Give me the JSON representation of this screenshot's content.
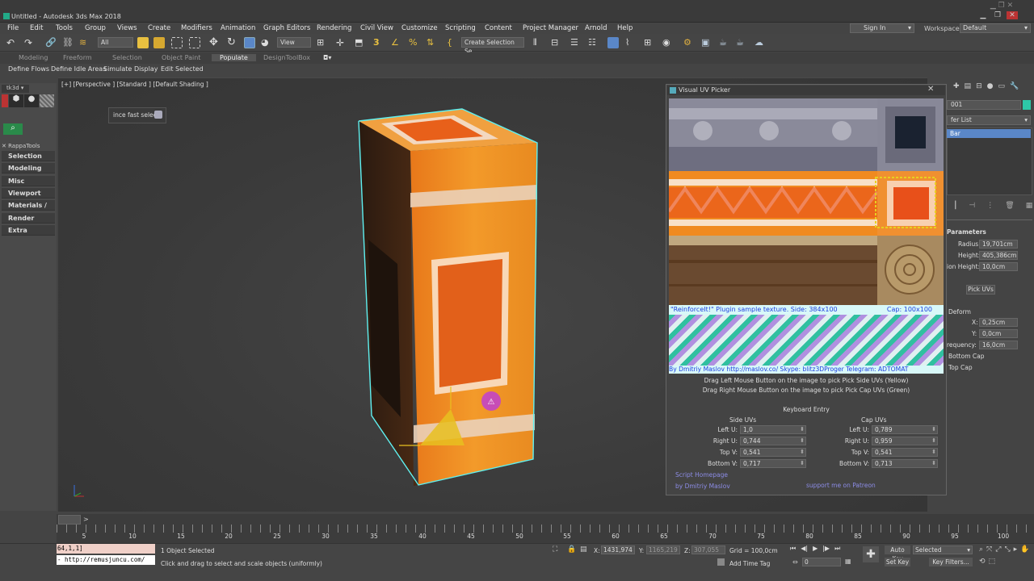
{
  "window": {
    "title": "Untitled - Autodesk 3ds Max 2018"
  },
  "menubar": {
    "items": [
      "File",
      "Edit",
      "Tools",
      "Group",
      "Views",
      "Create",
      "Modifiers",
      "Animation",
      "Graph Editors",
      "Rendering",
      "Civil View",
      "Customize",
      "Scripting",
      "Content",
      "Project Manager",
      "Arnold",
      "Help"
    ],
    "signin": "Sign In",
    "workspaces_label": "Workspaces:",
    "workspaces_value": "Default"
  },
  "toolbar": {
    "selection_filter": "All",
    "ref_coord": "View",
    "named_selection": "Create Selection Se"
  },
  "ribbon": {
    "tabs": [
      "Modeling",
      "Freeform",
      "Selection",
      "Object Paint",
      "Populate",
      "DesignToolBox"
    ],
    "sub_items": [
      "Define Flows",
      "Define Idle Areas",
      "Simulate",
      "Display",
      "Edit Selected"
    ]
  },
  "left_panel": {
    "tab_label": "tk3d",
    "rappa_label": "RappaTools",
    "items": [
      "Selection",
      "Modeling",
      "Misc",
      "Viewport",
      "Materials / Wir",
      "Render",
      "Extra"
    ]
  },
  "viewport": {
    "label": "[+] [Perspective ] [Standard ] [Default Shading ]",
    "tool_label": "ince fast selec"
  },
  "picker": {
    "title": "Visual UV Picker",
    "texture_caption": "\"ReinforceIt!\" Plugin sample texture. Side: 384x100",
    "texture_cap": "Cap: 100x100",
    "texture_credit": "By Dmitriy Maslov http://maslov.co/ Skype: blitz3DProger Telegram: ADTOMAT",
    "hint1": "Drag Left Mouse Button on the image to pick Pick Side UVs (Yellow)",
    "hint2": "Drag Right Mouse Button on the image to pick Pick Cap UVs (Green)",
    "keyboard_entry": "Keyboard Entry",
    "side_header": "Side UVs",
    "cap_header": "Cap UVs",
    "labels": [
      "Left U:",
      "Right U:",
      "Top V:",
      "Bottom V:"
    ],
    "side_values": [
      "1,0",
      "0,744",
      "0,541",
      "0,717"
    ],
    "cap_values": [
      "0,789",
      "0,959",
      "0,541",
      "0,713"
    ],
    "link_home": "Script Homepage",
    "link_author": "by Dmitriy Maslov",
    "link_patreon": "support me on Patreon"
  },
  "cmdpanel": {
    "name_value": "001",
    "modifier_list": "fer List",
    "stack_item": "Bar",
    "rollout": "Parameters",
    "radius_label": "Radius:",
    "radius": "19,701cm",
    "height_label": "Height:",
    "height": "405,386cm",
    "seg_height_label": "ion Height:",
    "seg_height": "10,0cm",
    "pick_uvs": "Pick UVs",
    "deform_label": "Deform",
    "x_label": "X:",
    "x": "0,25cm",
    "y_label": "Y:",
    "y": "0,0cm",
    "freq_label": "requency:",
    "freq": "16,0cm",
    "bottom_cap": "Bottom Cap",
    "top_cap": "Top Cap"
  },
  "timeline": {
    "ticks": [
      "5",
      "10",
      "15",
      "20",
      "25",
      "30",
      "35",
      "40",
      "45",
      "50",
      "55",
      "60",
      "65",
      "70",
      "75",
      "80",
      "85",
      "90",
      "95",
      "100"
    ]
  },
  "status": {
    "maxscript_line1": "64,1,1]",
    "maxscript_line2": "- http://remusjuncu.com/",
    "objects_selected": "1 Object Selected",
    "prompt": "Click and drag to select and scale objects (uniformly)",
    "x_label": "X:",
    "x_value": "1431,974",
    "y_label": "Y:",
    "y_value": "1165,219",
    "z_label": "Z:",
    "z_value": "307,055",
    "grid": "Grid = 100,0cm",
    "add_time_tag": "Add Time Tag",
    "frame": "0",
    "auto_key": "Auto Key",
    "selected": "Selected",
    "set_key": "Set Key",
    "key_filters": "Key Filters..."
  }
}
